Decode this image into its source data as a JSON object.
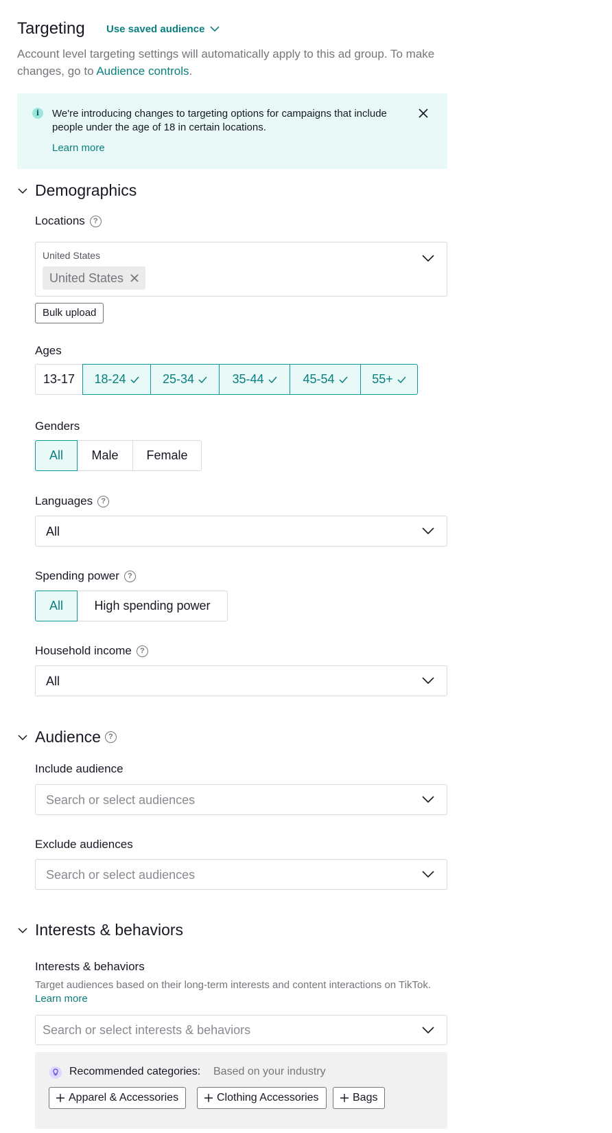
{
  "header": {
    "title": "Targeting",
    "saved_audience_label": "Use saved audience",
    "description_prefix": "Account level targeting settings will automatically apply to this ad group. To make changes, go to ",
    "description_link": "Audience controls",
    "description_suffix": "."
  },
  "notice": {
    "message": "We're introducing changes to targeting options for campaigns that include people under the age of 18 in certain locations.",
    "learn_more": "Learn more"
  },
  "demographics": {
    "section_title": "Demographics",
    "locations": {
      "label": "Locations",
      "small_label": "United States",
      "selected_tag": "United States",
      "bulk_upload": "Bulk upload"
    },
    "ages": {
      "label": "Ages",
      "options": [
        {
          "label": "13-17",
          "selected": false
        },
        {
          "label": "18-24",
          "selected": true
        },
        {
          "label": "25-34",
          "selected": true
        },
        {
          "label": "35-44",
          "selected": true
        },
        {
          "label": "45-54",
          "selected": true
        },
        {
          "label": "55+",
          "selected": true
        }
      ]
    },
    "genders": {
      "label": "Genders",
      "options": [
        {
          "label": "All",
          "selected": true
        },
        {
          "label": "Male",
          "selected": false
        },
        {
          "label": "Female",
          "selected": false
        }
      ]
    },
    "languages": {
      "label": "Languages",
      "value": "All"
    },
    "spending_power": {
      "label": "Spending power",
      "options": [
        {
          "label": "All",
          "selected": true
        },
        {
          "label": "High spending power",
          "selected": false
        }
      ]
    },
    "household_income": {
      "label": "Household income",
      "value": "All"
    }
  },
  "audience": {
    "section_title": "Audience",
    "include": {
      "label": "Include audience",
      "placeholder": "Search or select audiences"
    },
    "exclude": {
      "label": "Exclude audiences",
      "placeholder": "Search or select audiences"
    }
  },
  "interests": {
    "section_title": "Interests & behaviors",
    "label": "Interests & behaviors",
    "description": "Target audiences based on their long-term interests and content interactions on TikTok. ",
    "learn_more": "Learn more",
    "placeholder": "Search or select interests & behaviors",
    "recommended": {
      "title": "Recommended categories:",
      "subtitle": "Based on your industry",
      "chips": [
        "Apparel & Accessories",
        "Clothing Accessories",
        "Bags"
      ]
    }
  },
  "colors": {
    "accent": "#0a7f7f",
    "notice_bg": "#e8f9f8",
    "selected_bg": "#e8f9f8"
  },
  "icons": [
    "chevron-down-icon",
    "info-icon",
    "close-icon",
    "help-icon",
    "check-icon",
    "plus-icon",
    "bulb-icon"
  ]
}
